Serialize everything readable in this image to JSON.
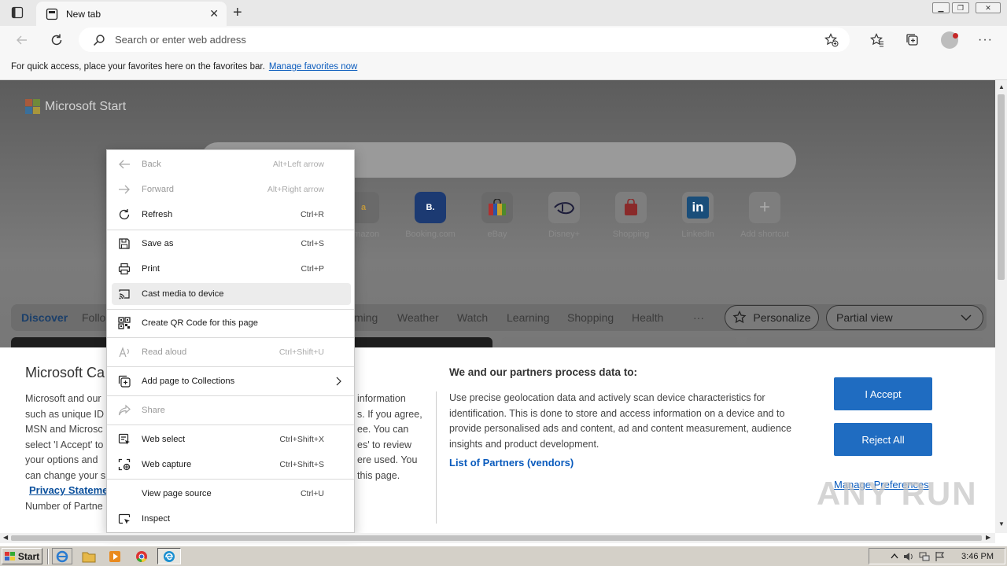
{
  "browser": {
    "tab_title": "New tab",
    "address_placeholder": "Search or enter web address",
    "favbar_text": "For quick access, place your favorites here on the favorites bar.",
    "favbar_link": "Manage favorites now"
  },
  "page": {
    "logo_text": "Microsoft Start",
    "tiles": [
      "Amazon",
      "Booking.com",
      "eBay",
      "Disney+",
      "Shopping",
      "LinkedIn",
      "Add shortcut"
    ],
    "feed_nav": [
      "Discover",
      "Follo",
      "ming",
      "Weather",
      "Watch",
      "Learning",
      "Shopping",
      "Health",
      "···"
    ],
    "personalize": "Personalize",
    "view_select": "Partial view"
  },
  "consent": {
    "title": "Microsoft Ca",
    "left_lines": [
      "Microsoft and our",
      "such as unique ID",
      "MSN and Microsc",
      "select 'I Accept' to",
      "your options and",
      "can change your s"
    ],
    "mid_lines": [
      "information",
      "s. If you agree,",
      "ee. You can",
      "es' to review",
      "ere used.  You",
      "this page."
    ],
    "privacy_link": "Privacy Stateme",
    "partners_count": "Number of Partne",
    "process_title": "We and our partners process data to:",
    "process_text": "Use precise geolocation data and actively scan device characteristics for identification. This is done to store and access information on a device and to provide personalised ads and content, ad and content measurement, audience insights and product development.",
    "partners_link": "List of Partners (vendors)",
    "accept": "I Accept",
    "reject": "Reject All",
    "manage": "Manage Preferences"
  },
  "context_menu": [
    {
      "label": "Back",
      "shortcut": "Alt+Left arrow",
      "disabled": true,
      "icon": "back-arrow-icon"
    },
    {
      "label": "Forward",
      "shortcut": "Alt+Right arrow",
      "disabled": true,
      "icon": "forward-arrow-icon"
    },
    {
      "label": "Refresh",
      "shortcut": "Ctrl+R",
      "disabled": false,
      "icon": "refresh-icon"
    },
    {
      "label": "Save as",
      "shortcut": "Ctrl+S",
      "disabled": false,
      "icon": "save-icon"
    },
    {
      "label": "Print",
      "shortcut": "Ctrl+P",
      "disabled": false,
      "icon": "print-icon"
    },
    {
      "label": "Cast media to device",
      "shortcut": "",
      "disabled": false,
      "icon": "cast-icon",
      "highlighted": true
    },
    {
      "label": "Create QR Code for this page",
      "shortcut": "",
      "disabled": false,
      "icon": "qr-code-icon"
    },
    {
      "label": "Read aloud",
      "shortcut": "Ctrl+Shift+U",
      "disabled": true,
      "icon": "read-aloud-icon"
    },
    {
      "label": "Add page to Collections",
      "shortcut": "",
      "disabled": false,
      "icon": "collections-icon",
      "submenu": true
    },
    {
      "label": "Share",
      "shortcut": "",
      "disabled": true,
      "icon": "share-icon"
    },
    {
      "label": "Web select",
      "shortcut": "Ctrl+Shift+X",
      "disabled": false,
      "icon": "web-select-icon"
    },
    {
      "label": "Web capture",
      "shortcut": "Ctrl+Shift+S",
      "disabled": false,
      "icon": "web-capture-icon"
    },
    {
      "label": "View page source",
      "shortcut": "Ctrl+U",
      "disabled": false,
      "icon": ""
    },
    {
      "label": "Inspect",
      "shortcut": "",
      "disabled": false,
      "icon": "inspect-icon"
    }
  ],
  "taskbar": {
    "start": "Start",
    "clock": "3:46 PM"
  },
  "watermark": "ANY RUN",
  "colors": {
    "accent": "#1f6cc1",
    "link": "#0a5bbd",
    "taskbar": "#d4d0c8"
  }
}
